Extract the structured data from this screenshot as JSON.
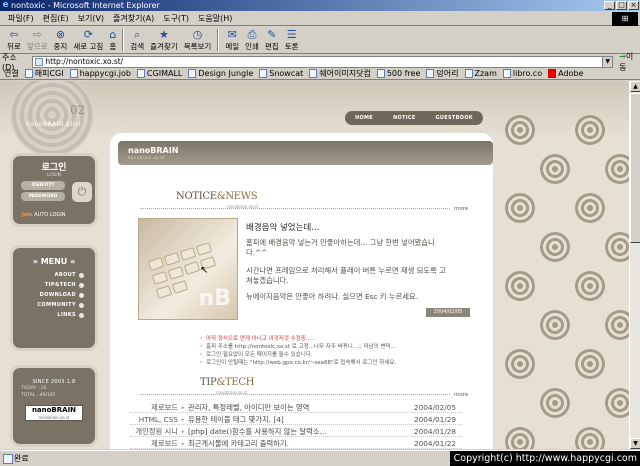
{
  "window": {
    "title": "nontoxic - Microsoft Internet Explorer",
    "buttons": [
      "_",
      "□",
      "×"
    ]
  },
  "menubar": [
    "파일(F)",
    "편집(E)",
    "보기(V)",
    "즐겨찾기(A)",
    "도구(T)",
    "도움말(H)"
  ],
  "toolbar": [
    {
      "label": "뒤로",
      "icon": "back-arrow-icon"
    },
    {
      "label": "앞으로",
      "icon": "forward-arrow-icon"
    },
    {
      "label": "중지",
      "icon": "stop-icon"
    },
    {
      "label": "새로 고침",
      "icon": "refresh-icon"
    },
    {
      "label": "홈",
      "icon": "home-icon"
    },
    {
      "label": "검색",
      "icon": "search-icon"
    },
    {
      "label": "즐겨찾기",
      "icon": "favorites-icon"
    },
    {
      "label": "목록보기",
      "icon": "history-icon"
    },
    {
      "label": "메일",
      "icon": "mail-icon"
    },
    {
      "label": "인쇄",
      "icon": "print-icon"
    },
    {
      "label": "편집",
      "icon": "edit-icon"
    },
    {
      "label": "토론",
      "icon": "discuss-icon"
    }
  ],
  "address": {
    "label": "주소(D)",
    "url": "http://nontoxic.xo.st/",
    "go": "이동"
  },
  "links": {
    "label": "연결",
    "items": [
      "해피CGI",
      "happycgi.job",
      "CGIMALL",
      "Design Jungle",
      "Snowcat",
      "쉐어이미지닷컴",
      "500 free",
      "덩어리",
      "Zzam",
      "libro.co",
      "Adobe"
    ]
  },
  "site": {
    "logo_text": "nanoBRAIN.blist",
    "logo_num": "02",
    "topnav": [
      "HOME",
      "NOTICE",
      "GUESTBOOK"
    ],
    "login": {
      "title": "로그인",
      "sub": "LOGIN",
      "identity": "IDENTITY",
      "password": "PASSWORD",
      "auto_prefix": "Join",
      "auto": "AUTO LOGIN"
    },
    "menu": {
      "title": "» MENU «",
      "items": [
        "ABOUT",
        "TIP&TECH",
        "DOWNLOAD",
        "COMMUNITY",
        "LINKS"
      ]
    },
    "stats": {
      "since": "SINCE 2003.1.8",
      "today": "TODAY : 18",
      "total": "TOTAL : 49/165",
      "badge1": "nanoBRAIN",
      "badge2": "nanobrain.xo.st"
    },
    "header": {
      "title": "nanoBRAIN",
      "sub": "nanobrain.xo.st"
    },
    "notice": {
      "title_a": "NOTICE",
      "title_b": "&NEWS",
      "sub": "nanobrain.xo.st",
      "more": "more",
      "img_text": "nB",
      "headline": "배경음악 넣었는데...",
      "p1": "홈피에 배경음악 넣는거 안좋아하는데... 그냥 한번 넣어봤습니다.^^",
      "p2": "시간나면 프레임으로 처리해서 플레이 버튼 누르면 재생 되도록 고쳐놓겠습니다.",
      "p3": "뉴에이지음악은 안좋아 하려나. 싫으면 Esc 키 누르세요.",
      "date": "2004/02/05",
      "bullets": [
        "아직 정식으로 연게 아니고 이것저것 수정중......",
        "홈피 주소를 http://nontoxic.xo.st 로 고정...너무 자주 바뀌니...;; 미남의 변덕...",
        "로그인 필요없이 모든 페이지를 들수 있습니다.",
        "로그인이 안될때는 \"http://web.gpo.co.kr/~sea88\"로 접속해서 로그인 하세요."
      ]
    },
    "tip": {
      "title_a": "TIP",
      "title_b": "&TECH",
      "sub": "nanobrain.xo.st",
      "more": "more",
      "rows": [
        {
          "cat": "제로보드",
          "title": "관리자, 특정레벨, 아이디만 보이는 영역",
          "date": "2004/02/05"
        },
        {
          "cat": "HTML, CSS",
          "title": "유용한 테이블 태그 몇가지. [4]",
          "date": "2004/01/29"
        },
        {
          "cat": "개인정원 시니",
          "title": "[php] date()함수를 사용하지 않는 달력소...",
          "date": "2004/01/28"
        },
        {
          "cat": "제로보드",
          "title": "최근게시물에 카테고리 출력하기.",
          "date": "2004/01/22"
        }
      ]
    }
  },
  "status": {
    "text": "완료",
    "copyright": "Copyright(c) http://www.happycgi.com"
  }
}
